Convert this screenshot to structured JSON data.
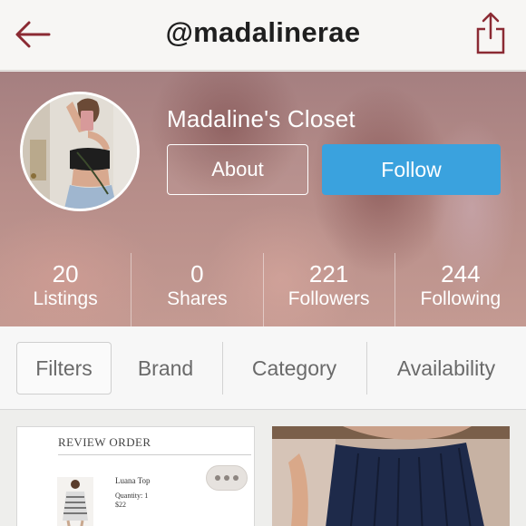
{
  "navbar": {
    "title": "@madalinerae",
    "back_icon": "back-arrow-icon",
    "share_icon": "share-icon",
    "accent_color": "#8b2a33"
  },
  "profile": {
    "closet_name": "Madaline's Closet",
    "about_label": "About",
    "follow_label": "Follow",
    "follow_color": "#3aa2de"
  },
  "stats": [
    {
      "count": "20",
      "label": "Listings"
    },
    {
      "count": "0",
      "label": "Shares"
    },
    {
      "count": "221",
      "label": "Followers"
    },
    {
      "count": "244",
      "label": "Following"
    }
  ],
  "filters": {
    "filters_label": "Filters",
    "tabs": [
      "Brand",
      "Category",
      "Availability"
    ]
  },
  "listings": {
    "first": {
      "heading": "REVIEW ORDER",
      "item_name": "Luana Top",
      "quantity": "Quantity: 1",
      "price": "$22"
    }
  }
}
